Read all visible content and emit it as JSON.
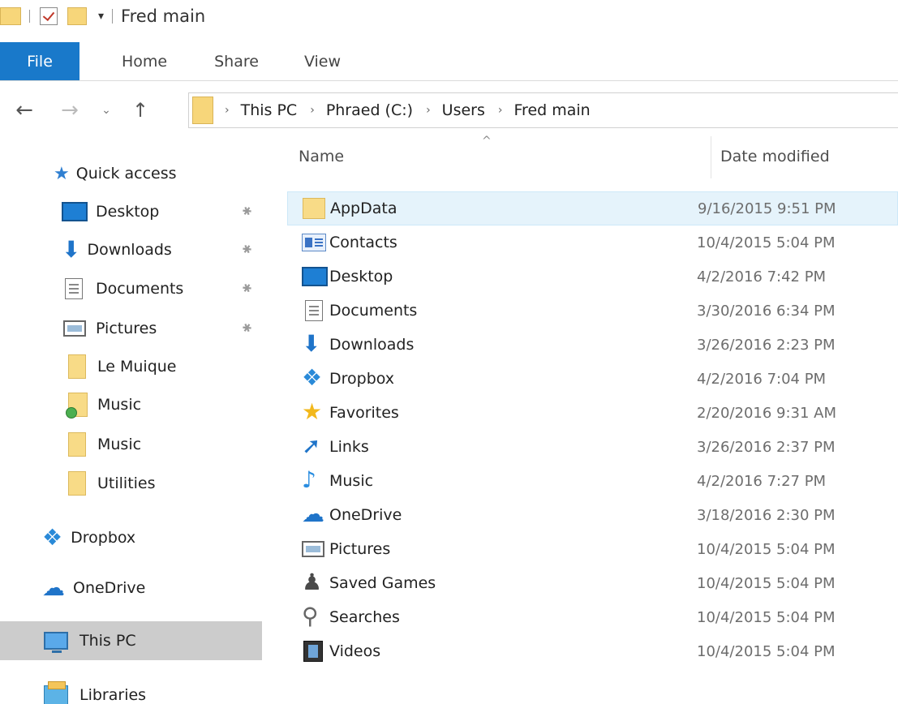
{
  "window": {
    "title": "Fred main",
    "quick_access_toolbar": {
      "dropdown_glyph": "▾"
    }
  },
  "ribbon": {
    "tabs": [
      "File",
      "Home",
      "Share",
      "View"
    ],
    "active_color": "#1979ca"
  },
  "address_bar": {
    "nav": {
      "back_glyph": "←",
      "forward_glyph": "→",
      "recent_glyph": "⌄",
      "up_glyph": "↑"
    },
    "separator": "›",
    "crumbs": [
      "This PC",
      "Phraed (C:)",
      "Users",
      "Fred main"
    ]
  },
  "nav_pane": {
    "quick_access_label": "Quick access",
    "pinned": [
      {
        "label": "Desktop",
        "icon": "desktop-icon"
      },
      {
        "label": "Downloads",
        "icon": "download-arrow-icon"
      },
      {
        "label": "Documents",
        "icon": "document-icon"
      },
      {
        "label": "Pictures",
        "icon": "pictures-icon"
      }
    ],
    "recent": [
      {
        "label": "Le Muique",
        "icon": "folder-icon"
      },
      {
        "label": "Music",
        "icon": "music-folder-synced-icon"
      },
      {
        "label": "Music",
        "icon": "folder-icon"
      },
      {
        "label": "Utilities",
        "icon": "folder-icon"
      }
    ],
    "roots": [
      {
        "label": "Dropbox",
        "icon": "dropbox-icon"
      },
      {
        "label": "OneDrive",
        "icon": "onedrive-cloud-icon"
      },
      {
        "label": "This PC",
        "icon": "computer-icon",
        "selected": true
      },
      {
        "label": "Libraries",
        "icon": "libraries-icon"
      }
    ],
    "pin_glyph": "📌"
  },
  "file_list": {
    "sort_indicator": "^",
    "columns": {
      "name": "Name",
      "date": "Date modified"
    },
    "rows": [
      {
        "name": "AppData",
        "date": "9/16/2015 9:51 PM",
        "icon": "folder-icon",
        "hover": true
      },
      {
        "name": "Contacts",
        "date": "10/4/2015 5:04 PM",
        "icon": "contacts-icon"
      },
      {
        "name": "Desktop",
        "date": "4/2/2016 7:42 PM",
        "icon": "desktop-icon"
      },
      {
        "name": "Documents",
        "date": "3/30/2016 6:34 PM",
        "icon": "document-icon"
      },
      {
        "name": "Downloads",
        "date": "3/26/2016 2:23 PM",
        "icon": "download-arrow-icon"
      },
      {
        "name": "Dropbox",
        "date": "4/2/2016 7:04 PM",
        "icon": "dropbox-icon"
      },
      {
        "name": "Favorites",
        "date": "2/20/2016 9:31 AM",
        "icon": "star-icon"
      },
      {
        "name": "Links",
        "date": "3/26/2016 2:37 PM",
        "icon": "link-arrow-icon"
      },
      {
        "name": "Music",
        "date": "4/2/2016 7:27 PM",
        "icon": "music-note-icon"
      },
      {
        "name": "OneDrive",
        "date": "3/18/2016 2:30 PM",
        "icon": "onedrive-cloud-icon"
      },
      {
        "name": "Pictures",
        "date": "10/4/2015 5:04 PM",
        "icon": "pictures-icon"
      },
      {
        "name": "Saved Games",
        "date": "10/4/2015 5:04 PM",
        "icon": "saved-games-icon"
      },
      {
        "name": "Searches",
        "date": "10/4/2015 5:04 PM",
        "icon": "search-icon"
      },
      {
        "name": "Videos",
        "date": "10/4/2015 5:04 PM",
        "icon": "video-icon"
      }
    ]
  }
}
